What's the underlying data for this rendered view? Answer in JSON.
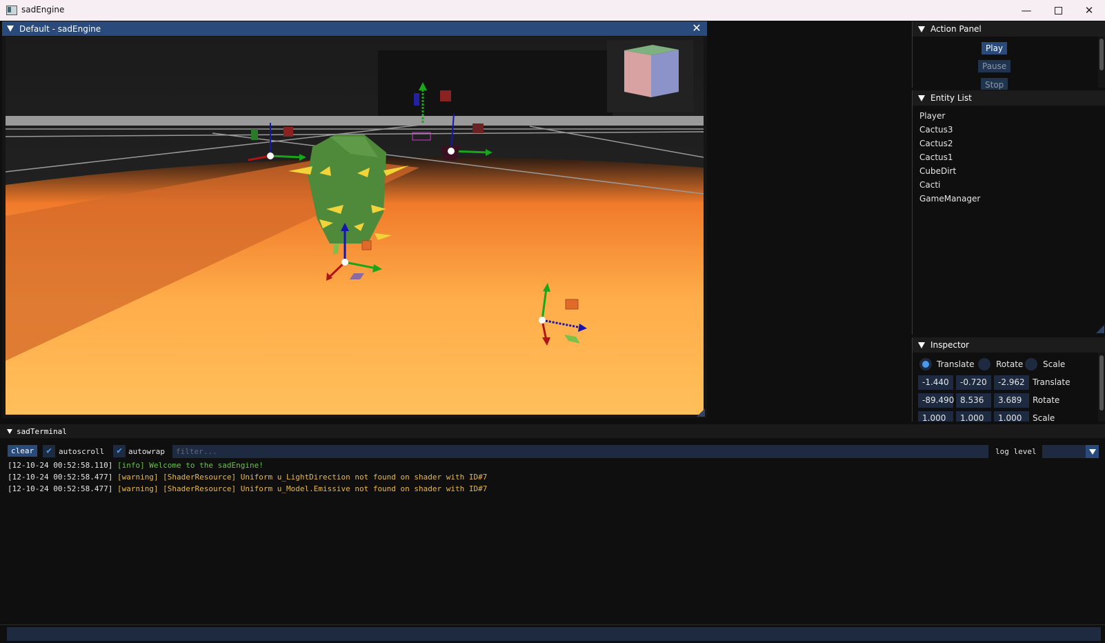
{
  "app": {
    "title": "sadEngine"
  },
  "viewport": {
    "title": "Default - sadEngine"
  },
  "action_panel": {
    "title": "Action Panel",
    "buttons": [
      "Play",
      "Pause",
      "Stop"
    ]
  },
  "entity_list": {
    "title": "Entity List",
    "items": [
      "Player",
      "Cactus3",
      "Cactus2",
      "Cactus1",
      "CubeDirt",
      "Cacti",
      "GameManager"
    ]
  },
  "inspector": {
    "title": "Inspector",
    "modes": [
      "Translate",
      "Rotate",
      "Scale"
    ],
    "selected_mode": "Translate",
    "rows": [
      {
        "label": "Translate",
        "values": [
          "-1.440",
          "-0.720",
          "-2.962"
        ]
      },
      {
        "label": "Rotate",
        "values": [
          "-89.490",
          "8.536",
          "3.689"
        ]
      },
      {
        "label": "Scale",
        "values": [
          "1.000",
          "1.000",
          "1.000"
        ]
      }
    ]
  },
  "terminal": {
    "title": "sadTerminal",
    "clear_label": "clear",
    "autoscroll_label": "autoscroll",
    "autowrap_label": "autowrap",
    "filter_placeholder": "filter...",
    "log_level_label": "log level",
    "lines": [
      {
        "ts": "[12-10-24 00:52:58.110]",
        "msg": "[info] Welcome to the sadEngine!",
        "level": "info"
      },
      {
        "ts": "[12-10-24 00:52:58.477]",
        "msg": "[warning] [ShaderResource] Uniform u_LightDirection not found on shader with ID#7",
        "level": "warning"
      },
      {
        "ts": "[12-10-24 00:52:58.477]",
        "msg": "[warning] [ShaderResource] Uniform u_Model.Emissive not found on shader with ID#7",
        "level": "warning"
      }
    ]
  },
  "colors": {
    "accent": "#294a7a",
    "info": "#6cc04a",
    "warning": "#e8b84a",
    "check": "#4a9aee"
  },
  "icons": [
    "app-icon",
    "minimize-icon",
    "maximize-icon",
    "close-icon",
    "collapse-triangle-icon",
    "checkmark-icon",
    "dropdown-arrow-icon"
  ]
}
